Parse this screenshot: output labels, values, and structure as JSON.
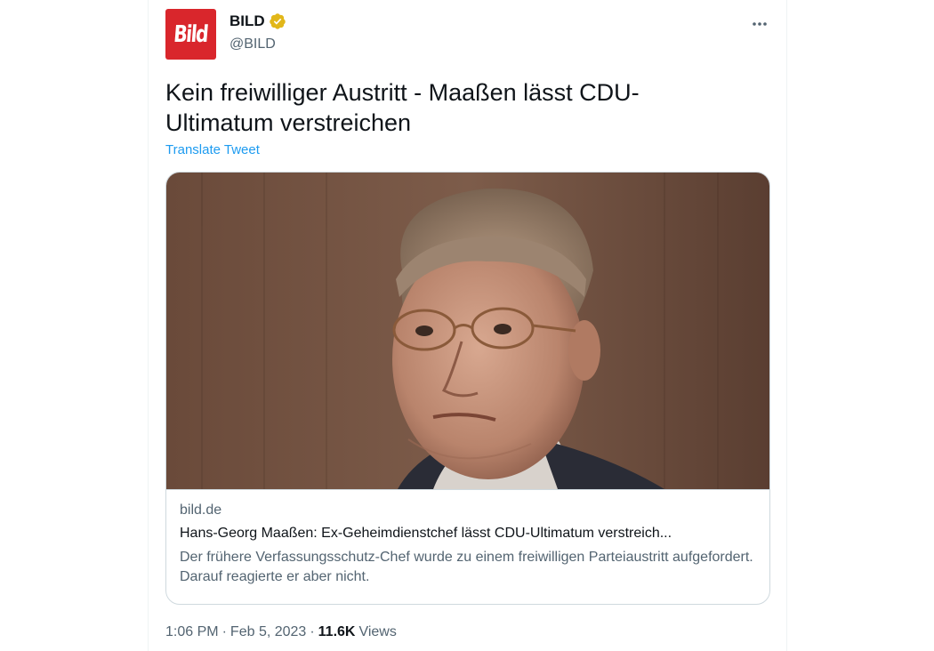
{
  "author": {
    "display_name": "BILD",
    "handle": "@BILD",
    "avatar_text": "Bild",
    "avatar_color": "#d9262c",
    "verified_icon": "gold-verified-badge-icon"
  },
  "more_icon": "more-dots-icon",
  "tweet": {
    "text": "Kein freiwilliger Austritt - Maaßen lässt CDU-Ultimatum verstreichen",
    "translate_label": "Translate Tweet"
  },
  "card": {
    "image": "portrait-photo",
    "domain": "bild.de",
    "title": "Hans-Georg Maaßen: Ex-Geheimdienstchef lässt CDU-Ultimatum verstreich...",
    "description": "Der frühere Verfassungsschutz-Chef wurde zu einem freiwilligen Parteiaustritt aufgefordert. Darauf reagierte er aber nicht."
  },
  "meta": {
    "time": "1:06 PM",
    "separator": "·",
    "date": "Feb 5, 2023",
    "views_count": "11.6K",
    "views_label": "Views"
  },
  "colors": {
    "link": "#1d9bf0",
    "secondary_text": "#536471",
    "primary_text": "#0f1419",
    "border": "#cfd9de",
    "verified_gold": "#e2b719"
  }
}
